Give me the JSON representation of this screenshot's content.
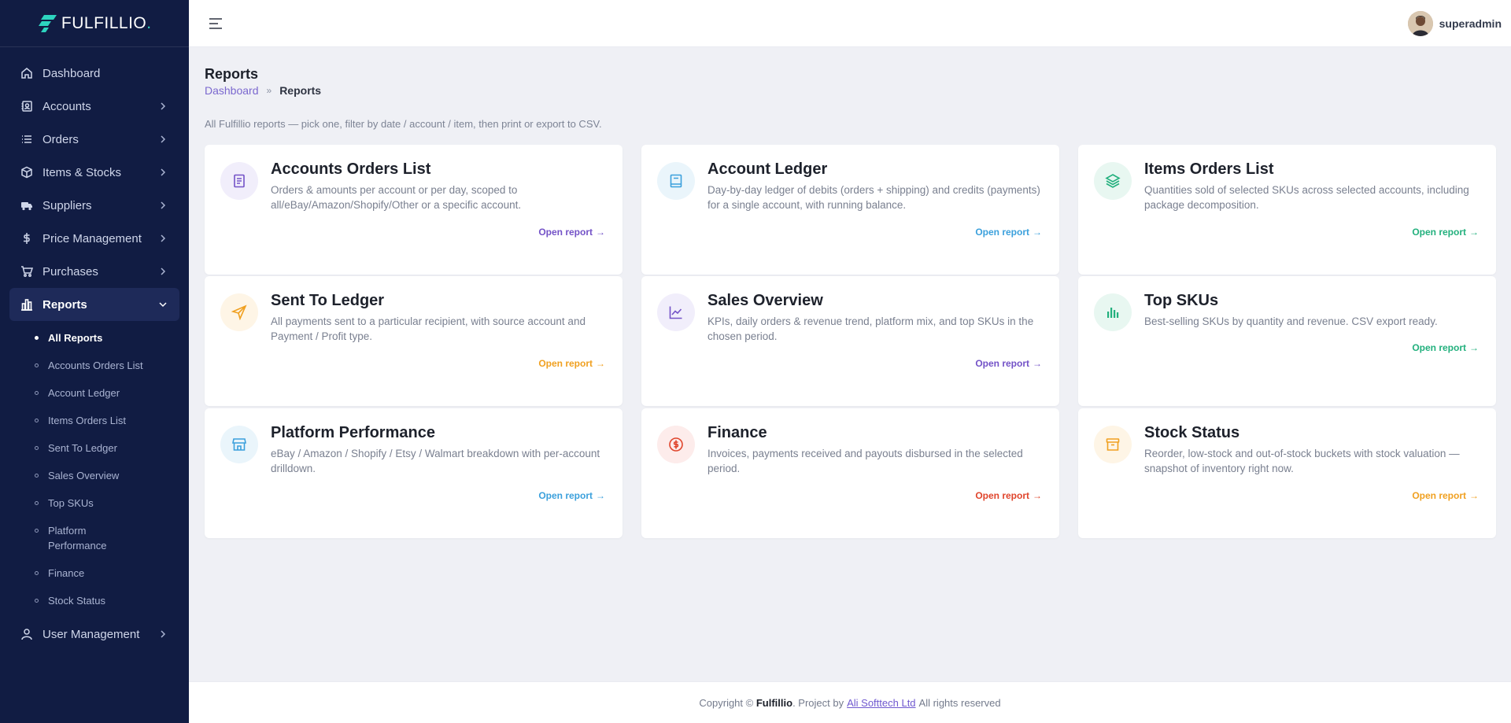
{
  "brand": {
    "name": "FULFILLIO",
    "dot": "."
  },
  "sidebar": {
    "items": [
      {
        "label": "Dashboard",
        "icon": "home-icon"
      },
      {
        "label": "Accounts",
        "icon": "contact-book-icon"
      },
      {
        "label": "Orders",
        "icon": "list-icon"
      },
      {
        "label": "Items & Stocks",
        "icon": "box-icon"
      },
      {
        "label": "Suppliers",
        "icon": "truck-icon"
      },
      {
        "label": "Price Management",
        "icon": "dollar-icon"
      },
      {
        "label": "Purchases",
        "icon": "cart-icon"
      },
      {
        "label": "Reports",
        "icon": "bar-chart-icon"
      },
      {
        "label": "User Management",
        "icon": "user-icon"
      }
    ],
    "reports_sub": [
      "All Reports",
      "Accounts Orders List",
      "Account Ledger",
      "Items Orders List",
      "Sent To Ledger",
      "Sales Overview",
      "Top SKUs",
      "Platform Performance",
      "Finance",
      "Stock Status"
    ]
  },
  "header": {
    "user": "superadmin"
  },
  "page": {
    "title": "Reports",
    "breadcrumb": {
      "home": "Dashboard",
      "current": "Reports"
    },
    "intro": "All Fulfillio reports — pick one, filter by date / account / item, then print or export to CSV."
  },
  "cards": [
    {
      "title": "Accounts Orders List",
      "desc": "Orders & amounts per account or per day, scoped to all/eBay/Amazon/Shopify/Other or a specific account.",
      "link": "Open report",
      "icon": "document-icon",
      "color": "#7352c7",
      "bg": "#f1eefb"
    },
    {
      "title": "Account Ledger",
      "desc": "Day-by-day ledger of debits (orders + shipping) and credits (payments) for a single account, with running balance.",
      "link": "Open report",
      "icon": "ledger-book-icon",
      "color": "#3ba0dc",
      "bg": "#eaf5fb"
    },
    {
      "title": "Items Orders List",
      "desc": "Quantities sold of selected SKUs across selected accounts, including package decomposition.",
      "link": "Open report",
      "icon": "layers-icon",
      "color": "#22b07d",
      "bg": "#e8f7f1"
    },
    {
      "title": "Sent To Ledger",
      "desc": "All payments sent to a particular recipient, with source account and Payment / Profit type.",
      "link": "Open report",
      "icon": "send-icon",
      "color": "#f0a020",
      "bg": "#fef5e6"
    },
    {
      "title": "Sales Overview",
      "desc": "KPIs, daily orders & revenue trend, platform mix, and top SKUs in the chosen period.",
      "link": "Open report",
      "icon": "line-chart-icon",
      "color": "#7352c7",
      "bg": "#f1eefb"
    },
    {
      "title": "Top SKUs",
      "desc": "Best-selling SKUs by quantity and revenue. CSV export ready.",
      "link": "Open report",
      "icon": "bar-chart-icon",
      "color": "#22b07d",
      "bg": "#e8f7f1"
    },
    {
      "title": "Platform Performance",
      "desc": "eBay / Amazon / Shopify / Etsy / Walmart breakdown with per-account drilldown.",
      "link": "Open report",
      "icon": "store-icon",
      "color": "#3ba0dc",
      "bg": "#eaf5fb"
    },
    {
      "title": "Finance",
      "desc": "Invoices, payments received and payouts disbursed in the selected period.",
      "link": "Open report",
      "icon": "dollar-circle-icon",
      "color": "#e0452c",
      "bg": "#fdeceb"
    },
    {
      "title": "Stock Status",
      "desc": "Reorder, low-stock and out-of-stock buckets with stock valuation — snapshot of inventory right now.",
      "link": "Open report",
      "icon": "archive-icon",
      "color": "#f0a020",
      "bg": "#fef5e6"
    }
  ],
  "footer": {
    "copyright": "Copyright ©",
    "brand": "Fulfillio",
    "project_by": ". Project by",
    "company": "Ali Softtech Ltd",
    "rights": "All rights reserved"
  }
}
